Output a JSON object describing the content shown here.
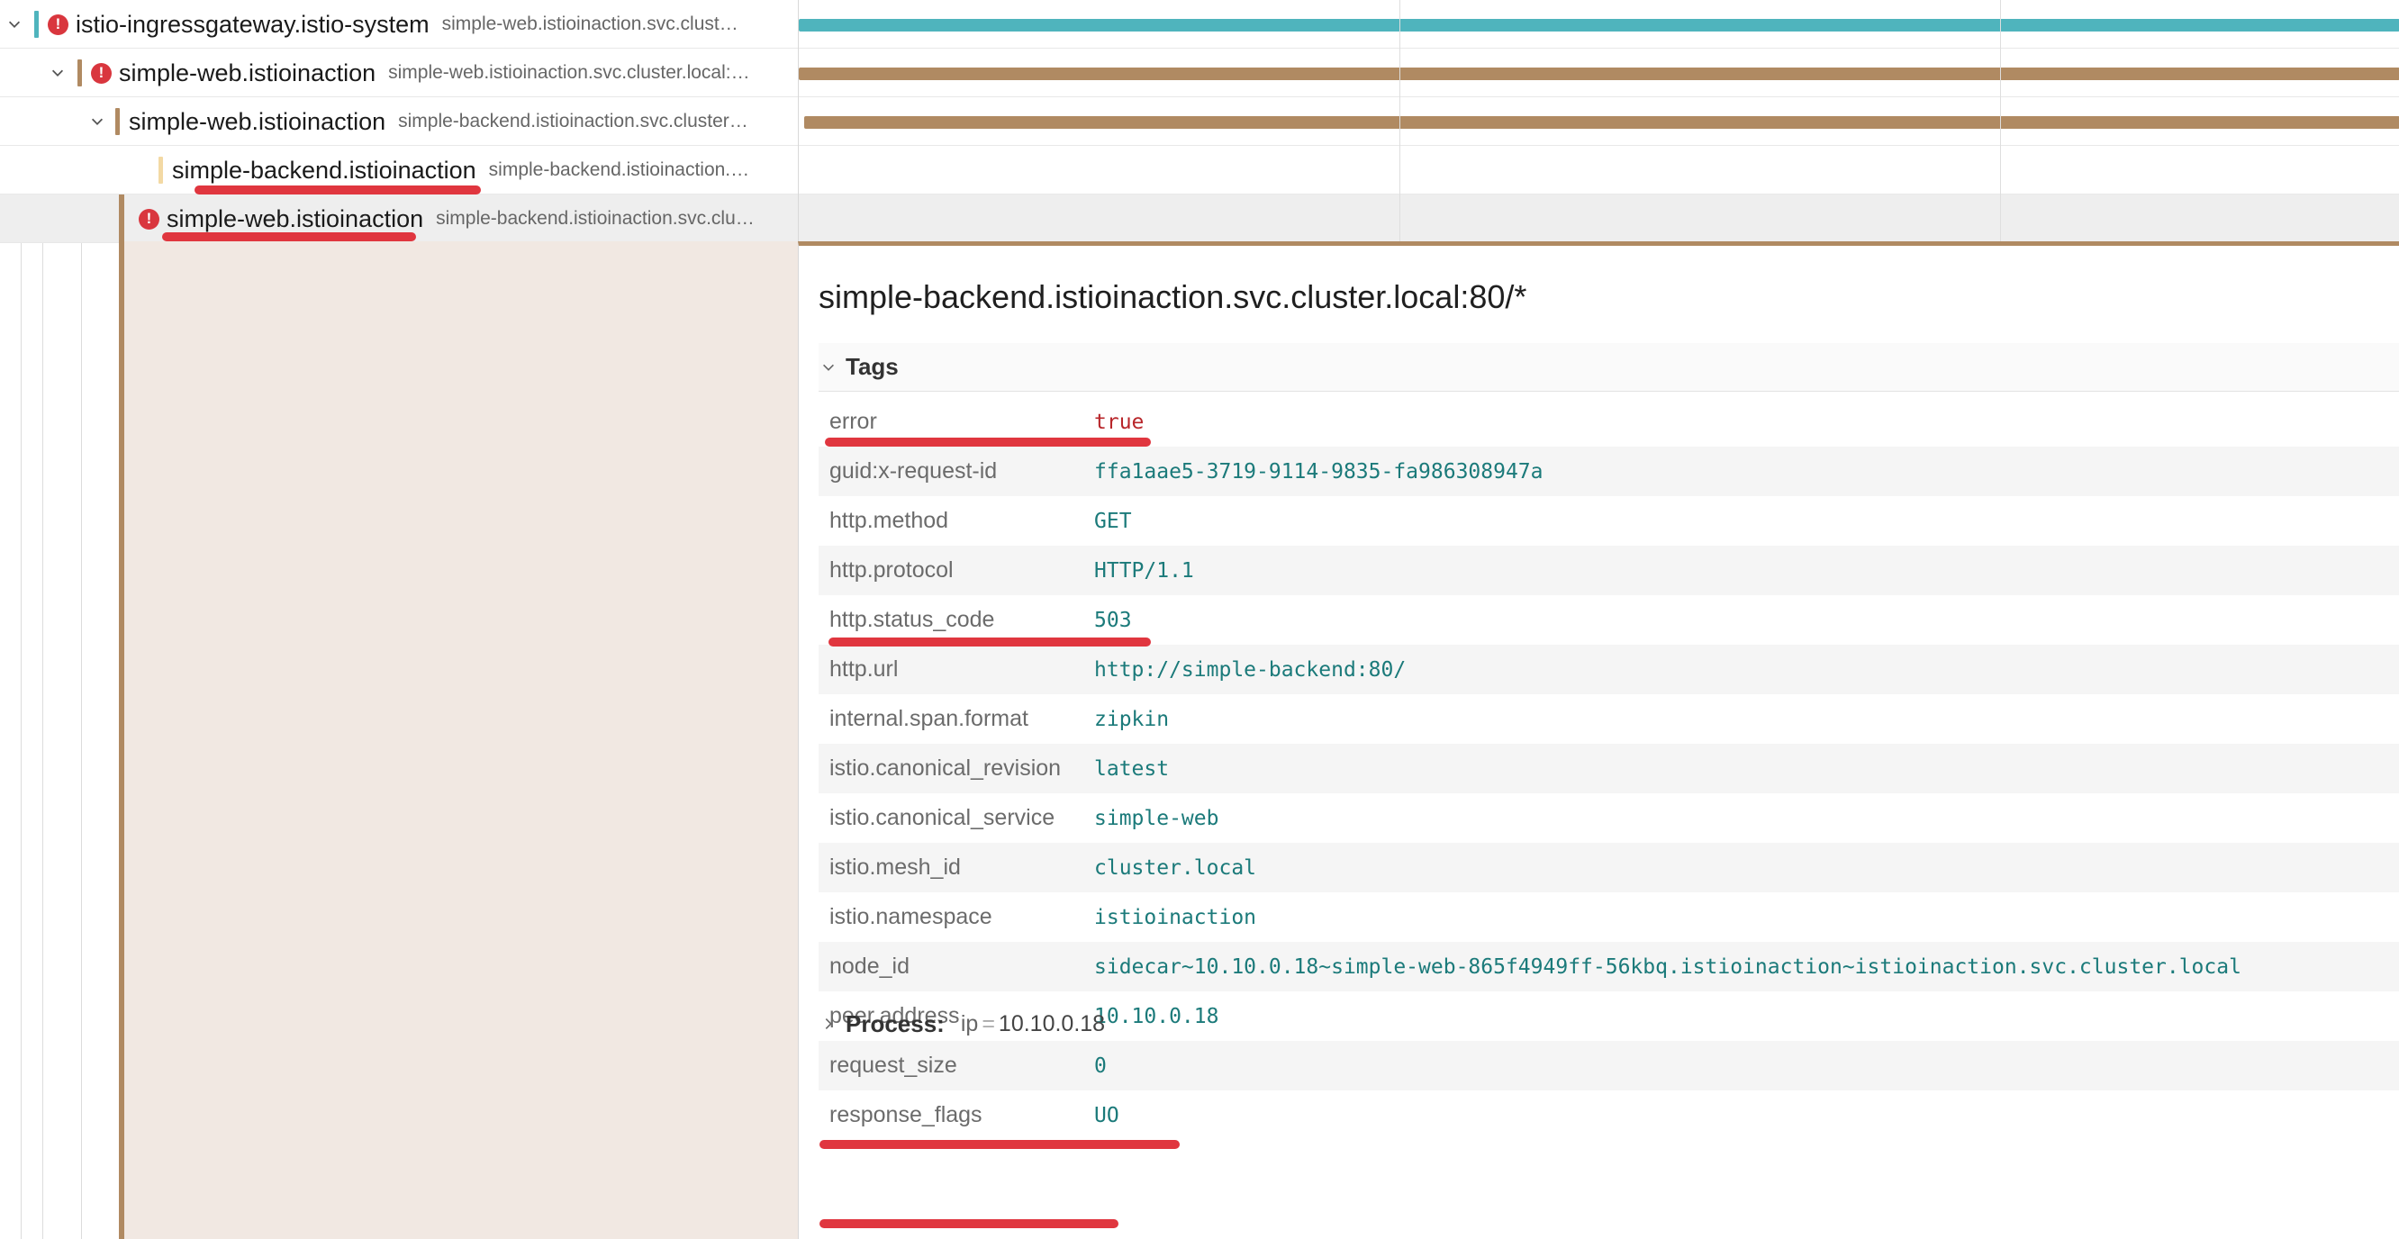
{
  "spans": [
    {
      "service": "istio-ingressgateway.istio-system",
      "operation": "simple-web.istioinaction.svc.clust…",
      "error": true,
      "color": "#4fb4bd",
      "collapsible": true
    },
    {
      "service": "simple-web.istioinaction",
      "operation": "simple-web.istioinaction.svc.cluster.local:…",
      "error": true,
      "color": "#b08a62",
      "collapsible": true
    },
    {
      "service": "simple-web.istioinaction",
      "operation": "simple-backend.istioinaction.svc.cluster…",
      "error": false,
      "color": "#b08a62",
      "collapsible": true
    },
    {
      "service": "simple-backend.istioinaction",
      "operation": "simple-backend.istioinaction.…",
      "error": false,
      "color": "#f3d9a4",
      "collapsible": false
    },
    {
      "service": "simple-web.istioinaction",
      "operation": "simple-backend.istioinaction.svc.clu…",
      "error": true,
      "color": "#b08a62",
      "collapsible": false
    }
  ],
  "detail": {
    "title": "simple-backend.istioinaction.svc.cluster.local:80/*",
    "tags_label": "Tags",
    "tags": [
      {
        "key": "error",
        "value": "true"
      },
      {
        "key": "guid:x-request-id",
        "value": "ffa1aae5-3719-9114-9835-fa986308947a"
      },
      {
        "key": "http.method",
        "value": "GET"
      },
      {
        "key": "http.protocol",
        "value": "HTTP/1.1"
      },
      {
        "key": "http.status_code",
        "value": "503"
      },
      {
        "key": "http.url",
        "value": "http://simple-backend:80/"
      },
      {
        "key": "internal.span.format",
        "value": "zipkin"
      },
      {
        "key": "istio.canonical_revision",
        "value": "latest"
      },
      {
        "key": "istio.canonical_service",
        "value": "simple-web"
      },
      {
        "key": "istio.mesh_id",
        "value": "cluster.local"
      },
      {
        "key": "istio.namespace",
        "value": "istioinaction"
      },
      {
        "key": "node_id",
        "value": "sidecar~10.10.0.18~simple-web-865f4949ff-56kbq.istioinaction~istioinaction.svc.cluster.local"
      },
      {
        "key": "peer.address",
        "value": "10.10.0.18"
      },
      {
        "key": "request_size",
        "value": "0"
      },
      {
        "key": "response_flags",
        "value": "UO"
      }
    ],
    "process_label": "Process:",
    "process_key": "ip",
    "process_eq": "=",
    "process_value": "10.10.0.18"
  },
  "colors": {
    "accent_teal": "#4fb4bd",
    "accent_brown": "#b08a62",
    "error_red": "#d9363e",
    "annotation_red": "#e0363f"
  }
}
